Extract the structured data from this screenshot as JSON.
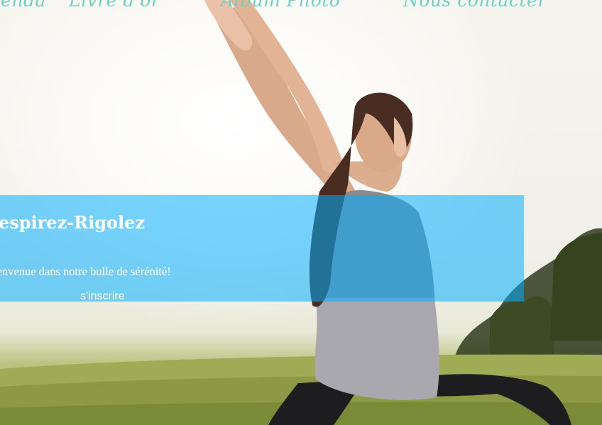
{
  "nav": {
    "items": [
      {
        "label": "Agenda"
      },
      {
        "label": "Livre d'or"
      },
      {
        "label": "Album Photo"
      },
      {
        "label": "Nous contacter"
      }
    ]
  },
  "banner": {
    "title": "Respirez-Rigolez",
    "subtitle": "Bienvenue dans notre bulle de sérénité!",
    "link_label": "s'inscrire",
    "color": "#00aeff"
  },
  "hero": {
    "image": "woman-yoga-pose-photo"
  }
}
